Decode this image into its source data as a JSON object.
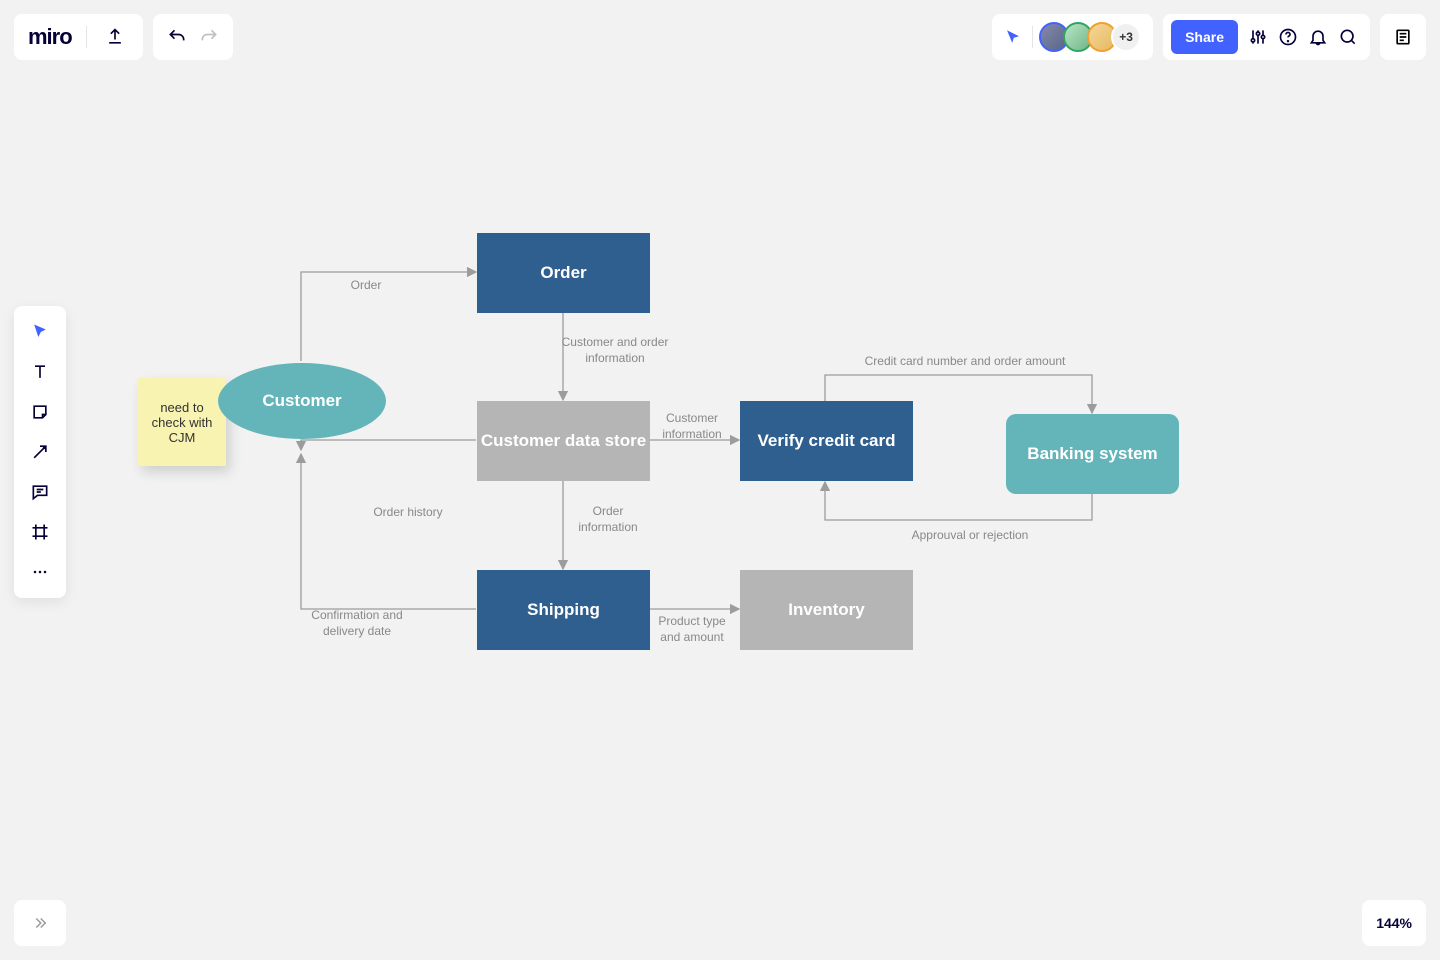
{
  "app": {
    "logo": "miro"
  },
  "presence": {
    "overflow": "+3"
  },
  "header": {
    "share_label": "Share"
  },
  "footer": {
    "zoom": "144%"
  },
  "diagram": {
    "sticky": {
      "text": "need to check with CJM"
    },
    "nodes": {
      "customer": "Customer",
      "order": "Order",
      "customer_data_store": "Customer data store",
      "shipping": "Shipping",
      "verify_credit_card": "Verify credit card",
      "inventory": "Inventory",
      "banking_system": "Banking system"
    },
    "edges": {
      "order": "Order",
      "customer_order_info": "Customer and order\ninformation",
      "order_history": "Order history",
      "confirm_delivery": "Confirmation and\ndelivery date",
      "customer_info": "Customer\ninformation",
      "order_info": "Order\ninformation",
      "product_type_amount": "Product type\nand amount",
      "cc_number_amount": "Credit card number and order amount",
      "approval_rejection": "Approuval or rejection"
    }
  }
}
